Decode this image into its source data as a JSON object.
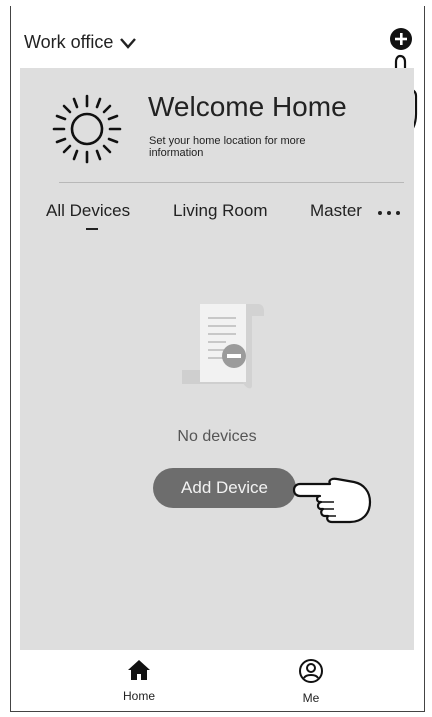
{
  "header": {
    "location_label": "Work office"
  },
  "welcome": {
    "title": "Welcome Home",
    "subtitle": "Set your home location for more information"
  },
  "tabs": [
    {
      "label": "All Devices",
      "active": true
    },
    {
      "label": "Living Room",
      "active": false
    },
    {
      "label": "Master",
      "active": false
    }
  ],
  "empty_state": {
    "message": "No devices",
    "button_label": "Add Device"
  },
  "bottom_nav": [
    {
      "label": "Home",
      "icon": "home-icon"
    },
    {
      "label": "Me",
      "icon": "user-icon"
    }
  ],
  "colors": {
    "content_bg": "#dedede",
    "button_bg": "#6d6d6d"
  }
}
